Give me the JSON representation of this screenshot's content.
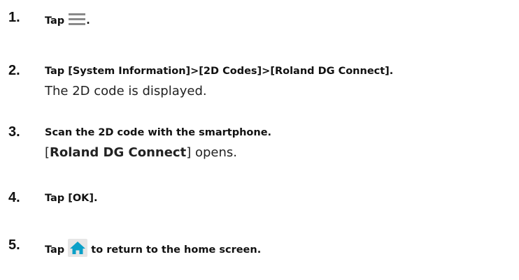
{
  "steps": [
    {
      "number": "1.",
      "before": "Tap ",
      "icon": "hamburger-menu-icon",
      "after": "."
    },
    {
      "number": "2.",
      "text": "Tap [System Information]>[2D Codes]>[Roland DG Connect].",
      "result": "The 2D code is displayed."
    },
    {
      "number": "3.",
      "text": "Scan the 2D code with the smartphone.",
      "result_open": "[",
      "result_bold": "Roland DG Connect",
      "result_close": "] opens."
    },
    {
      "number": "4.",
      "text": "Tap [OK]."
    },
    {
      "number": "5.",
      "before": "Tap ",
      "icon": "home-icon",
      "after": " to return to the home screen."
    }
  ],
  "colors": {
    "home_icon_bg": "#e6e6e6",
    "home_icon_fg": "#0aa0c8",
    "menu_icon": "#8a8a8a"
  }
}
